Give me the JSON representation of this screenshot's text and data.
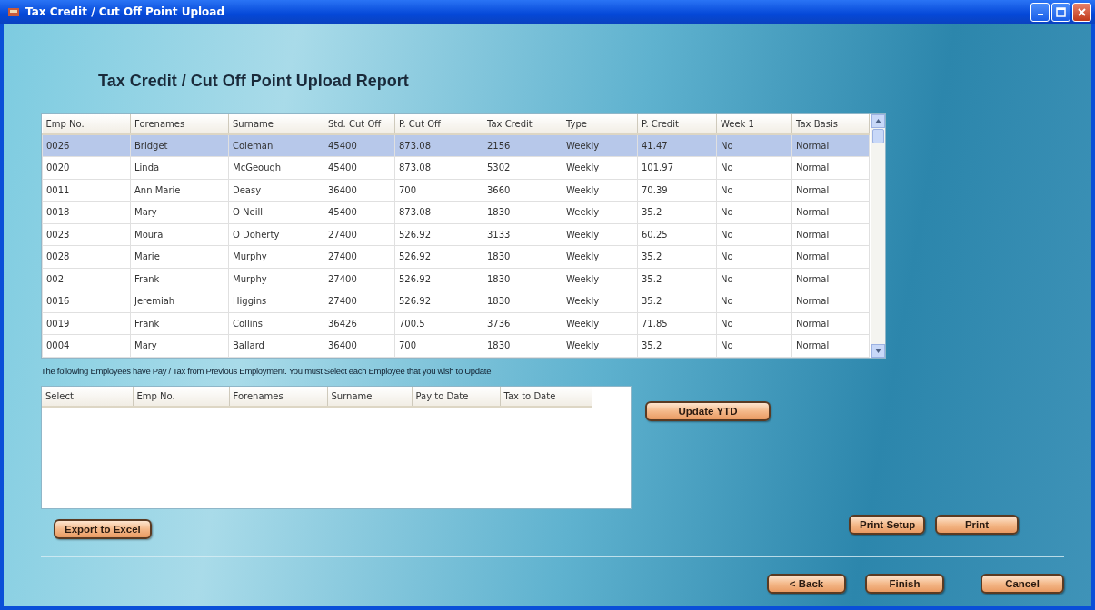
{
  "window": {
    "title": "Tax Credit / Cut Off Point Upload"
  },
  "heading": "Tax Credit / Cut Off Point Upload Report",
  "main_table": {
    "columns": [
      "Emp No. ",
      "Forenames",
      "Surname",
      "Std. Cut Off",
      "P. Cut Off",
      "Tax Credit",
      "Type",
      "P. Credit",
      "Week 1",
      "Tax Basis"
    ],
    "rows": [
      {
        "selected": true,
        "cells": [
          "0026",
          "Bridget",
          "Coleman",
          "45400",
          "873.08",
          "2156",
          "Weekly",
          "41.47",
          "No",
          "Normal"
        ]
      },
      {
        "selected": false,
        "cells": [
          "0020",
          "Linda",
          "McGeough",
          "45400",
          "873.08",
          "5302",
          "Weekly",
          "101.97",
          "No",
          "Normal"
        ]
      },
      {
        "selected": false,
        "cells": [
          "0011",
          "Ann Marie",
          "Deasy",
          "36400",
          "700",
          "3660",
          "Weekly",
          "70.39",
          "No",
          "Normal"
        ]
      },
      {
        "selected": false,
        "cells": [
          "0018",
          "Mary",
          "O Neill",
          "45400",
          "873.08",
          "1830",
          "Weekly",
          "35.2",
          "No",
          "Normal"
        ]
      },
      {
        "selected": false,
        "cells": [
          "0023",
          "Moura",
          "O Doherty",
          "27400",
          "526.92",
          "3133",
          "Weekly",
          "60.25",
          "No",
          "Normal"
        ]
      },
      {
        "selected": false,
        "cells": [
          "0028",
          "Marie",
          "Murphy",
          "27400",
          "526.92",
          "1830",
          "Weekly",
          "35.2",
          "No",
          "Normal"
        ]
      },
      {
        "selected": false,
        "cells": [
          "002",
          "Frank",
          "Murphy",
          "27400",
          "526.92",
          "1830",
          "Weekly",
          "35.2",
          "No",
          "Normal"
        ]
      },
      {
        "selected": false,
        "cells": [
          "0016",
          "Jeremiah",
          "Higgins",
          "27400",
          "526.92",
          "1830",
          "Weekly",
          "35.2",
          "No",
          "Normal"
        ]
      },
      {
        "selected": false,
        "cells": [
          "0019",
          "Frank",
          "Collins",
          "36426",
          "700.5",
          "3736",
          "Weekly",
          "71.85",
          "No",
          "Normal"
        ]
      },
      {
        "selected": false,
        "cells": [
          "0004",
          "Mary",
          "Ballard",
          "36400",
          "700",
          "1830",
          "Weekly",
          "35.2",
          "No",
          "Normal"
        ]
      }
    ]
  },
  "notice": "The following Employees have Pay / Tax from Previous Employment. You must Select each Employee that you wish to Update",
  "ytd_table": {
    "columns": [
      "Select",
      "Emp No.",
      "Forenames",
      "Surname",
      "Pay to Date",
      "Tax to Date"
    ]
  },
  "buttons": {
    "update_ytd": "Update YTD",
    "export": "Export to Excel",
    "print_setup": "Print Setup",
    "print": "Print",
    "back": "< Back",
    "finish": "Finish",
    "cancel": "Cancel"
  }
}
